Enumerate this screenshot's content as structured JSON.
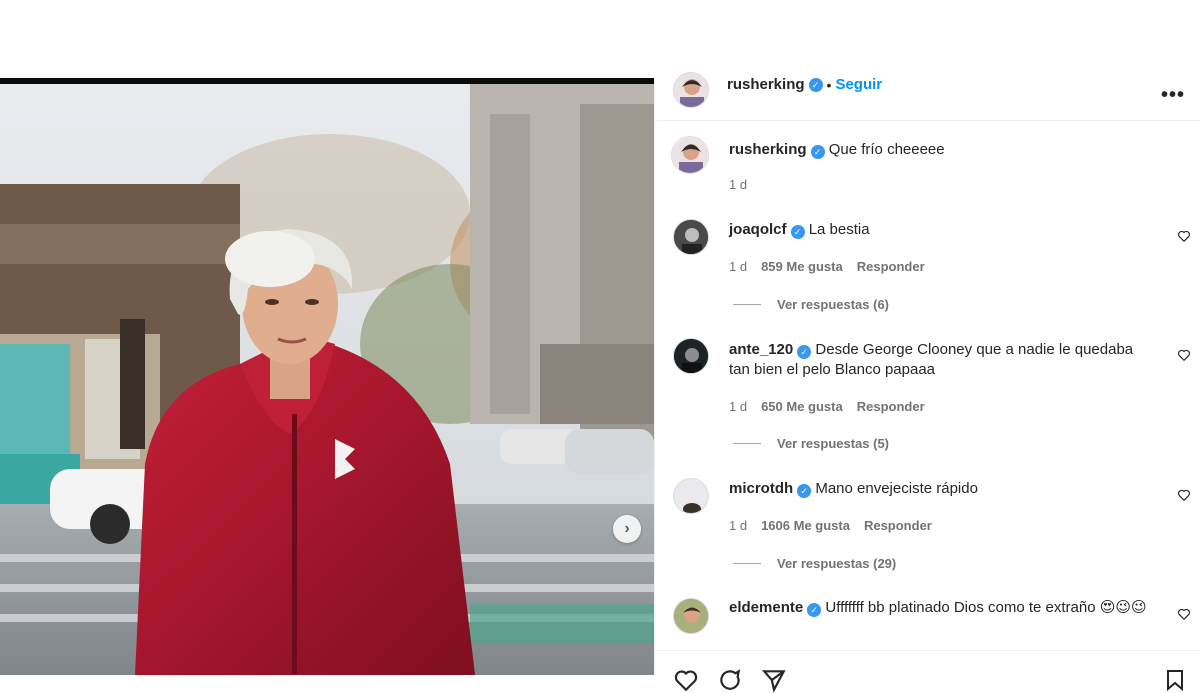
{
  "post": {
    "author": "rusherking",
    "follow_label": "Seguir",
    "more_label": "•••",
    "caption": "Que frío cheeeee",
    "caption_time": "1 d",
    "next_arrow": "›"
  },
  "comments": [
    {
      "user": "joaqolcf",
      "text": "La bestia",
      "time": "1 d",
      "likes": "859 Me gusta",
      "reply": "Responder",
      "view_replies": "Ver respuestas (6)"
    },
    {
      "user": "ante_120",
      "text": "Desde George Clooney que a nadie le quedaba tan bien el pelo Blanco papaaa",
      "time": "1 d",
      "likes": "650 Me gusta",
      "reply": "Responder",
      "view_replies": "Ver respuestas (5)"
    },
    {
      "user": "microtdh",
      "text": "Mano envejeciste rápido",
      "time": "1 d",
      "likes": "1606 Me gusta",
      "reply": "Responder",
      "view_replies": "Ver respuestas (29)"
    },
    {
      "user": "eldemente",
      "text": "Ufffffff bb platinado Dios como te extraño 😍😉😉",
      "time": "",
      "likes": "",
      "reply": "",
      "view_replies": ""
    }
  ],
  "icons": {
    "verified": "verified-badge-icon",
    "heart": "heart-icon",
    "comment": "comment-icon",
    "share": "share-icon",
    "save": "bookmark-icon"
  },
  "colors": {
    "accent": "#0095f6",
    "verified": "#3897f0",
    "jacket": "#a5162c"
  }
}
